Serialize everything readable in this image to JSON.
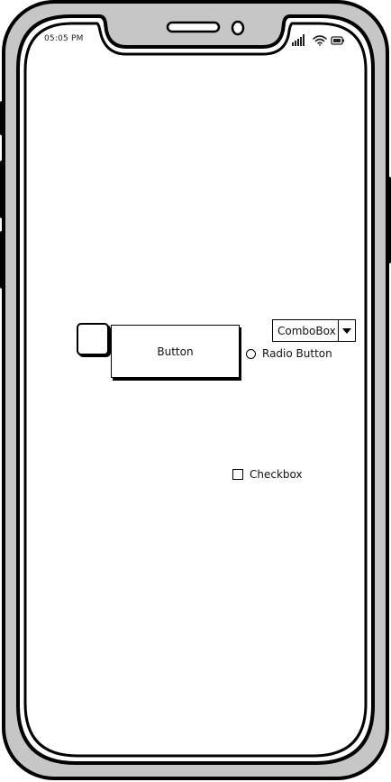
{
  "status_bar": {
    "time": "05:05 PM",
    "signal_icon": "signal-bars-icon",
    "wifi_icon": "wifi-icon",
    "battery_icon": "battery-icon"
  },
  "content": {
    "square_button_icon": "rounded-square-icon",
    "button_label": "Button",
    "combo_box": {
      "value": "ComboBox",
      "arrow_icon": "dropdown-arrow-icon"
    },
    "radio_button_label": "Radio Button",
    "checkbox_label": "Checkbox"
  },
  "colors": {
    "phone_frame": "#c6c6c6",
    "outline": "#000000",
    "screen": "#ffffff"
  }
}
